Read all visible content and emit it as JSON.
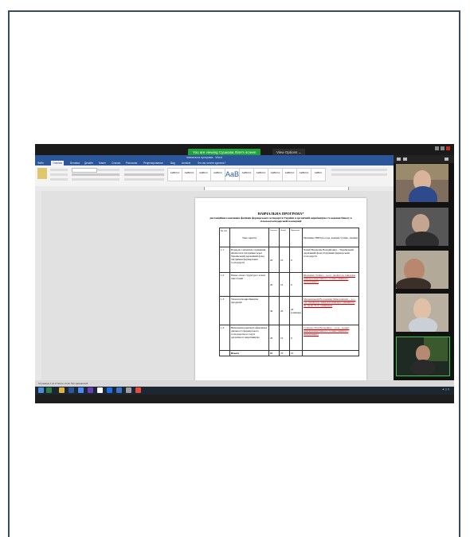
{
  "zoom": {
    "share_banner": "You are viewing Сушкова Ліля's screen",
    "view_options": "View Options ⌄"
  },
  "word": {
    "title": "навчальна програма - Word",
    "tabs": [
      "Файл",
      "Главная",
      "Вставка",
      "Дизайн",
      "Макет",
      "Ссылки",
      "Рассылки",
      "Рецензирование",
      "Вид",
      "Acrobat",
      "Что вы хотите сделать?"
    ],
    "active_tab": "Главная",
    "styles": [
      "AaBbCcl",
      "AaBbCcl",
      "AaBbCc",
      "AaBbCc",
      "AaB",
      "AaBbCcl",
      "AaBbCcl",
      "AaBbCcl",
      "AaBbCcl",
      "AaBbCcl",
      "AaBbC"
    ],
    "status": "Страница 1 из 2     Число слов: 511     украинский"
  },
  "document": {
    "heading": "НАВЧАЛЬНА ПРОГРАМА*",
    "subheading": "дистанційного навчання фахівців фермерських господарств України в органічній виробництва та ведення бізнесу в сільськогосподарській кооперації",
    "table": {
      "header": [
        "№ з/п",
        "Тема заняття",
        "Загалом",
        "Лекції",
        "Практичні",
        "Прізвище НПП (посада, вчений ступінь, звання)"
      ],
      "rows": [
        {
          "num": "1.1",
          "topic": "Порядок і механізм отримання фінансової підтримки через Український державний фонд підтримки фермерських господарств",
          "a": "20",
          "b": "10",
          "c": "0",
          "teacher": "Чалий Валентин Валерійович – Український державний фонд підтримки фермерських господарств"
        },
        {
          "num": "1.2",
          "topic": "Бізнес-план: структура і етапи підготовки",
          "a": "20",
          "b": "10",
          "c": "0",
          "teacher": "Шевченко Тетяна – д.е.н., професор, завідувач кафедри виробничого та інвестиційного менеджменту"
        },
        {
          "num": "1.3",
          "topic": "Технологія виробництва продукції",
          "a": "40",
          "b": "20",
          "c": "20 (семінар)",
          "teacher": "Мельницький Володимир Миколайович – д.с.-г.н., професор, завідувач кафедри садівництва ім. проф. В.Л. Симиренка"
        },
        {
          "num": "1.4",
          "topic": "Визначення критерії ефективної діяльності фермерського господарства в галузі органічного виробництва",
          "a": "20",
          "b": "10",
          "c": "0",
          "teacher": "Сушкова Ліля Валеріївна – д.е.н., доцент кафедри виробничого та інвестиційного менеджменту"
        },
        {
          "num": "",
          "topic": "Всього",
          "a": "80",
          "b": "70",
          "c": "10",
          "teacher": ""
        }
      ]
    }
  },
  "colors": {
    "zoom_green": "#1fa339",
    "word_blue": "#2b579a",
    "frame_border": "#3a4b5e"
  }
}
